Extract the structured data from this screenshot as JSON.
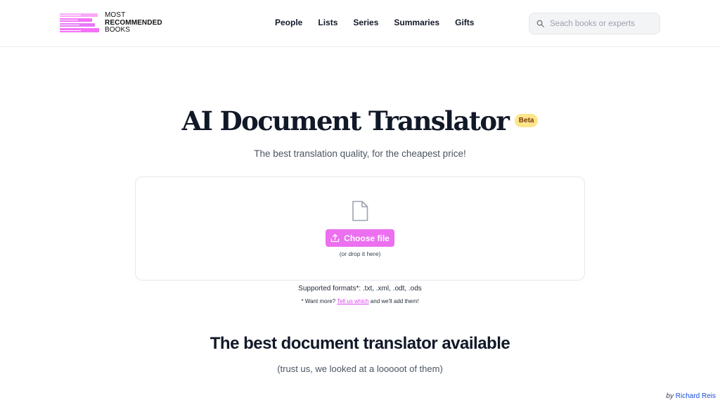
{
  "header": {
    "logo": {
      "line1": "MOST",
      "line2": "RECOMMENDED",
      "line3": "BOOKS",
      "accent": "#f472f6"
    },
    "nav": [
      {
        "label": "People"
      },
      {
        "label": "Lists"
      },
      {
        "label": "Series"
      },
      {
        "label": "Summaries"
      },
      {
        "label": "Gifts"
      }
    ],
    "search": {
      "placeholder": "Seach books or experts",
      "value": "",
      "icon": "search-icon"
    }
  },
  "hero": {
    "title": "AI Document Translator",
    "badge": "Beta",
    "subtitle": "The best translation quality, for the cheapest price!"
  },
  "upload": {
    "icon": "file-icon",
    "button_label": "Choose file",
    "button_icon": "upload-icon",
    "hint": "(or drop it here)",
    "button_color": "#ec6ff0"
  },
  "formats": {
    "text": "Supported formats*: .txt, .xml, .odt, .ods",
    "more_prefix": "* Want more?",
    "more_link": "Tell us which",
    "more_suffix": "and we'll add them!"
  },
  "section": {
    "title": "The best document translator available",
    "subtitle": "(trust us, we looked at a looooot of them)"
  },
  "credit": {
    "prefix": "by",
    "author": "Richard Reis"
  }
}
